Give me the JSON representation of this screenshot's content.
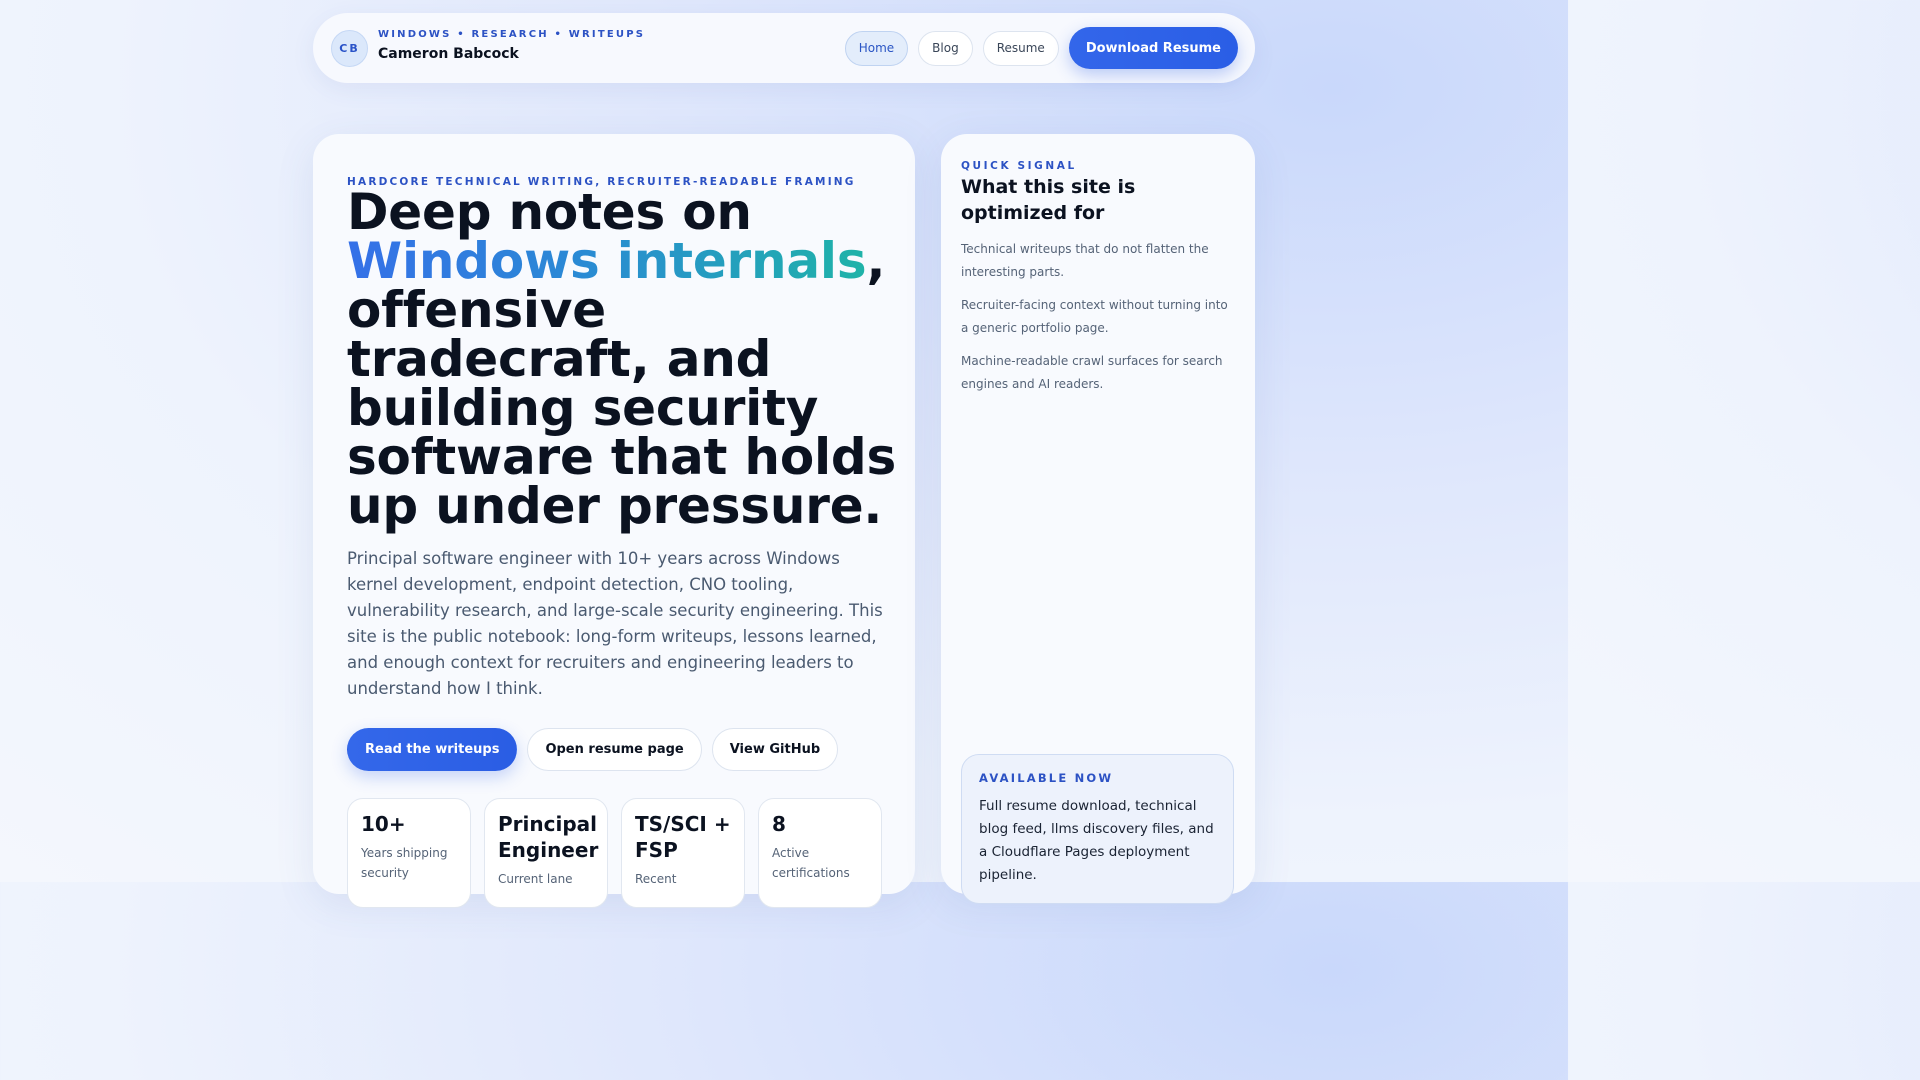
{
  "header": {
    "avatar_initials": "CB",
    "kicker": "WINDOWS • RESEARCH • WRITEUPS",
    "name": "Cameron Babcock",
    "nav": [
      {
        "label": "Home",
        "active": true
      },
      {
        "label": "Blog",
        "active": false
      },
      {
        "label": "Resume",
        "active": false
      }
    ],
    "download_label": "Download Resume"
  },
  "hero": {
    "kicker": "HARDCORE TECHNICAL WRITING, RECRUITER-READABLE FRAMING",
    "title_before": "Deep notes on ",
    "title_highlight": "Windows internals",
    "title_after": ", offensive tradecraft, and building security software that holds up under pressure.",
    "body": "Principal software engineer with 10+ years across Windows kernel development, endpoint detection, CNO tooling, vulnerability research, and large-scale security engineering. This site is the public notebook: long-form writeups, lessons learned, and enough context for recruiters and engineering leaders to understand how I think.",
    "cta": {
      "primary": "Read the writeups",
      "resume": "Open resume page",
      "github": "View GitHub"
    },
    "stats": [
      {
        "value": "10+",
        "label": "Years shipping security"
      },
      {
        "value": "Principal Engineer",
        "label": "Current lane"
      },
      {
        "value": "TS/SCI + FSP",
        "label": "Recent"
      },
      {
        "value": "8",
        "label": "Active certifications"
      }
    ]
  },
  "side": {
    "kicker": "QUICK SIGNAL",
    "title": "What this site is optimized for",
    "items": [
      "Technical writeups that do not flatten the interesting parts.",
      "Recruiter-facing context without turning into a generic portfolio page.",
      "Machine-readable crawl surfaces for search engines and AI readers."
    ],
    "available": {
      "kicker": "AVAILABLE NOW",
      "text": "Full resume download, technical blog feed, llms discovery files, and a Cloudflare Pages deployment pipeline."
    }
  },
  "colors": {
    "accent": "#2a5ee6",
    "kicker": "#2c52c4",
    "gradient_start": "#3570e8",
    "gradient_end": "#1fb3a8"
  }
}
